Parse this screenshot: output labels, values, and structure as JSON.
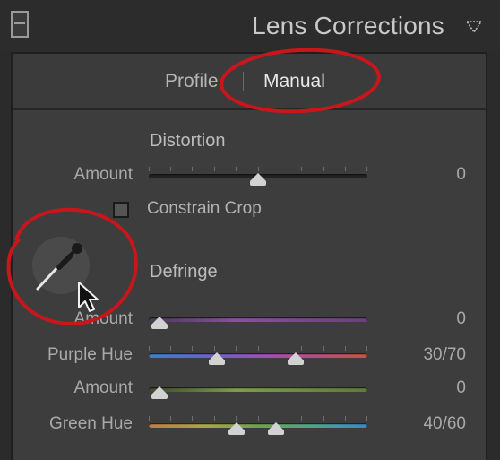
{
  "panel": {
    "title": "Lens Corrections",
    "tabs": [
      {
        "label": "Profile",
        "active": false
      },
      {
        "label": "Manual",
        "active": true
      }
    ]
  },
  "distortion": {
    "title": "Distortion",
    "amount_label": "Amount",
    "amount_value": "0",
    "amount_level": 0.5,
    "constrain_crop_label": "Constrain Crop",
    "constrain_crop_checked": false
  },
  "defringe": {
    "title": "Defringe",
    "purple_amount_label": "Amount",
    "purple_amount_value": "0",
    "purple_amount_level": 0.0,
    "purple_hue_label": "Purple Hue",
    "purple_hue_value": "30/70",
    "purple_hue_range": [
      30,
      70
    ],
    "green_amount_label": "Amount",
    "green_amount_value": "0",
    "green_amount_level": 0.0,
    "green_hue_label": "Green Hue",
    "green_hue_value": "40/60",
    "green_hue_range": [
      40,
      60
    ]
  },
  "colors": {
    "annotation_red": "#c8161d",
    "purple_track": "#8a4fa6",
    "green_track": "#7d9c4a"
  },
  "icons": [
    "panel-toggle-icon",
    "collapse-triangle-icon",
    "eyedropper-icon",
    "cursor-arrow-icon"
  ]
}
